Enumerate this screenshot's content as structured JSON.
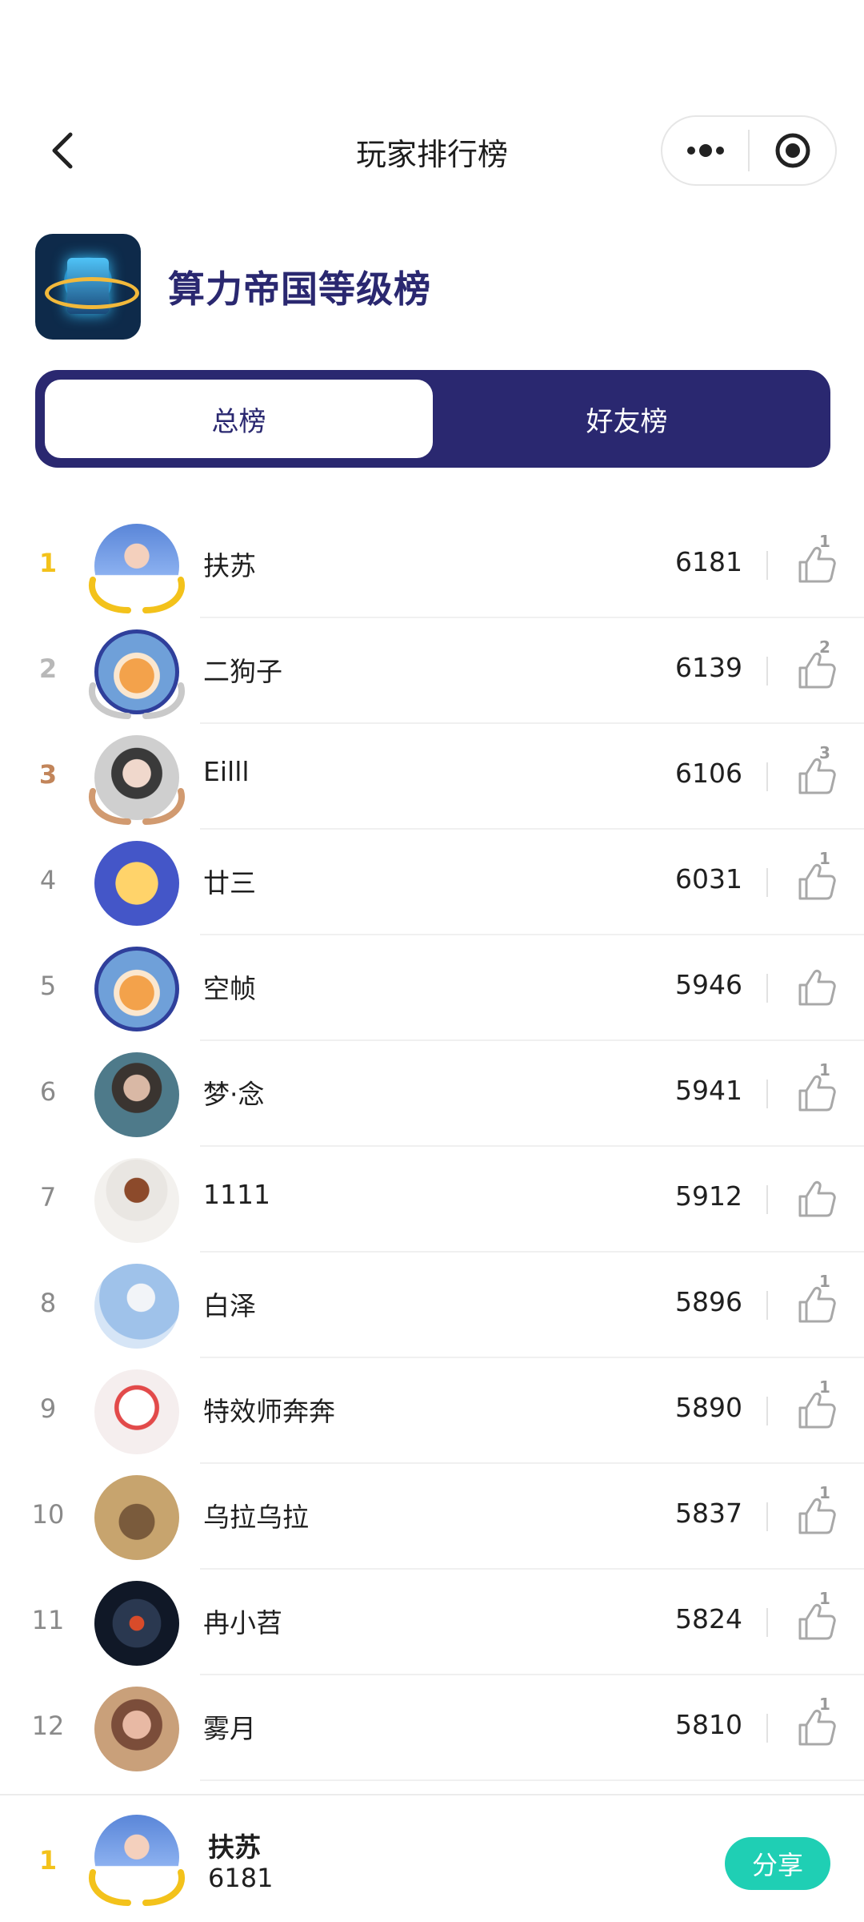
{
  "nav": {
    "title": "玩家排行榜"
  },
  "header": {
    "game_title": "算力帝国等级榜"
  },
  "tabs": {
    "overall": "总榜",
    "friends": "好友榜",
    "active": "overall"
  },
  "rows": [
    {
      "rank": "1",
      "name": "扶苏",
      "score": "6181",
      "likes": "1",
      "avatar": "av-blue",
      "medal": "gold"
    },
    {
      "rank": "2",
      "name": "二狗子",
      "score": "6139",
      "likes": "2",
      "avatar": "av-dog",
      "medal": "silver"
    },
    {
      "rank": "3",
      "name": "Eilll",
      "score": "6106",
      "likes": "3",
      "avatar": "av-girl",
      "medal": "bronze"
    },
    {
      "rank": "4",
      "name": "廿三",
      "score": "6031",
      "likes": "1",
      "avatar": "av-yellow",
      "medal": ""
    },
    {
      "rank": "5",
      "name": "空帧",
      "score": "5946",
      "likes": "",
      "avatar": "av-dog",
      "medal": ""
    },
    {
      "rank": "6",
      "name": "梦·念",
      "score": "5941",
      "likes": "1",
      "avatar": "av-boy",
      "medal": ""
    },
    {
      "rank": "7",
      "name": "1111",
      "score": "5912",
      "likes": "",
      "avatar": "av-cup",
      "medal": ""
    },
    {
      "rank": "8",
      "name": "白泽",
      "score": "5896",
      "likes": "1",
      "avatar": "av-sky",
      "medal": ""
    },
    {
      "rank": "9",
      "name": "特效师奔奔",
      "score": "5890",
      "likes": "1",
      "avatar": "av-anime",
      "medal": ""
    },
    {
      "rank": "10",
      "name": "乌拉乌拉",
      "score": "5837",
      "likes": "1",
      "avatar": "av-cat",
      "medal": ""
    },
    {
      "rank": "11",
      "name": "冉小苕",
      "score": "5824",
      "likes": "1",
      "avatar": "av-robot",
      "medal": ""
    },
    {
      "rank": "12",
      "name": "雾月",
      "score": "5810",
      "likes": "1",
      "avatar": "av-warrior",
      "medal": ""
    }
  ],
  "me": {
    "rank": "1",
    "name": "扶苏",
    "score": "6181",
    "share_label": "分享"
  },
  "colors": {
    "brand": "#2a2870",
    "gold": "#f3c21b",
    "silver": "#b8b8b8",
    "bronze": "#c2855a",
    "share": "#1fcfb4"
  },
  "icons": {
    "back": "chevron-left-icon",
    "more": "more-dots-icon",
    "close": "target-circle-icon",
    "like": "thumbs-up-icon"
  }
}
